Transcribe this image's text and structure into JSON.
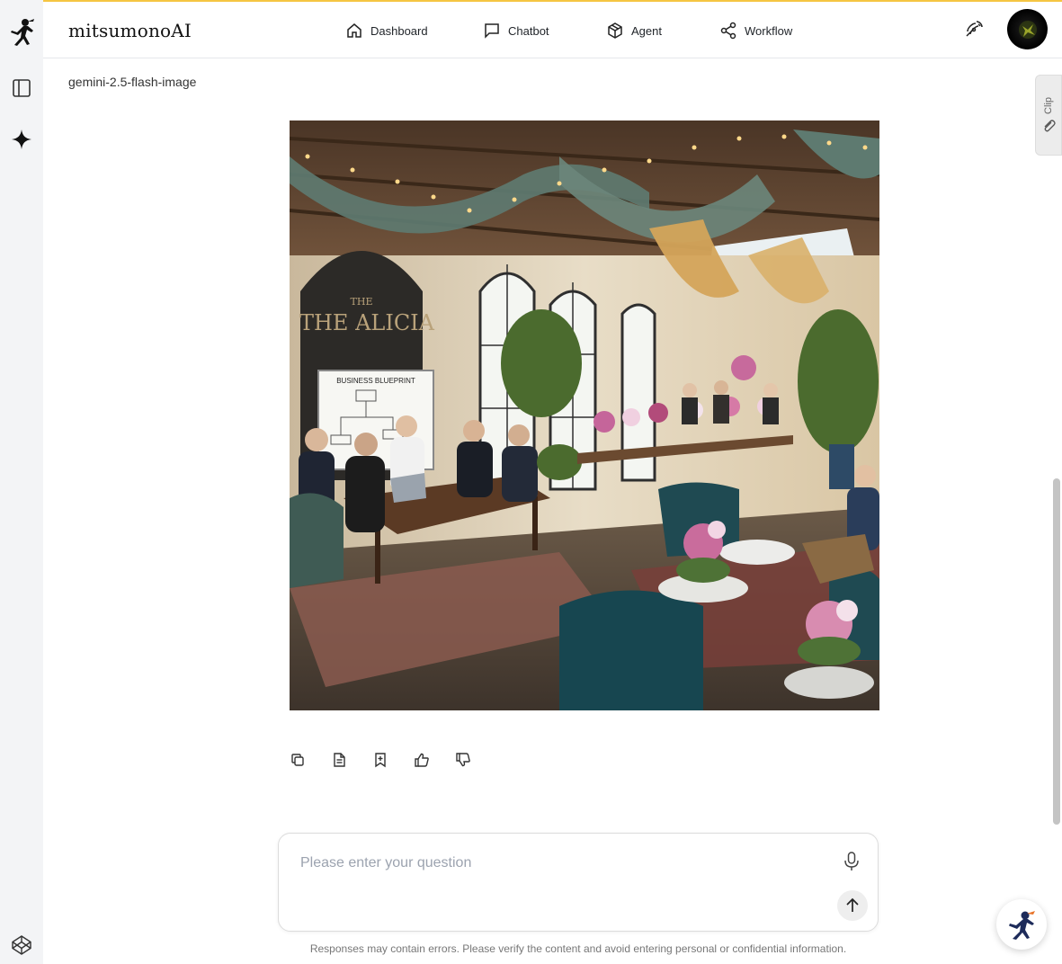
{
  "app": {
    "brand": "mitsumonoAI"
  },
  "nav": {
    "items": [
      {
        "label": "Dashboard",
        "icon": "home-icon"
      },
      {
        "label": "Chatbot",
        "icon": "chat-bubble-icon"
      },
      {
        "label": "Agent",
        "icon": "cube-icon"
      },
      {
        "label": "Workflow",
        "icon": "share-nodes-icon"
      }
    ]
  },
  "message": {
    "model": "gemini-2.5-flash-image",
    "image_text": {
      "sign": "THE ALICIA",
      "board": "BUSINESS BLUEPRINT"
    }
  },
  "clip": {
    "label": "Clip"
  },
  "composer": {
    "placeholder": "Please enter your question",
    "disclaimer": "Responses may contain errors. Please verify the content and avoid entering personal or confidential information."
  },
  "colors": {
    "accent_top": "#f5c542",
    "sidebar_bg": "#f3f4f6"
  }
}
